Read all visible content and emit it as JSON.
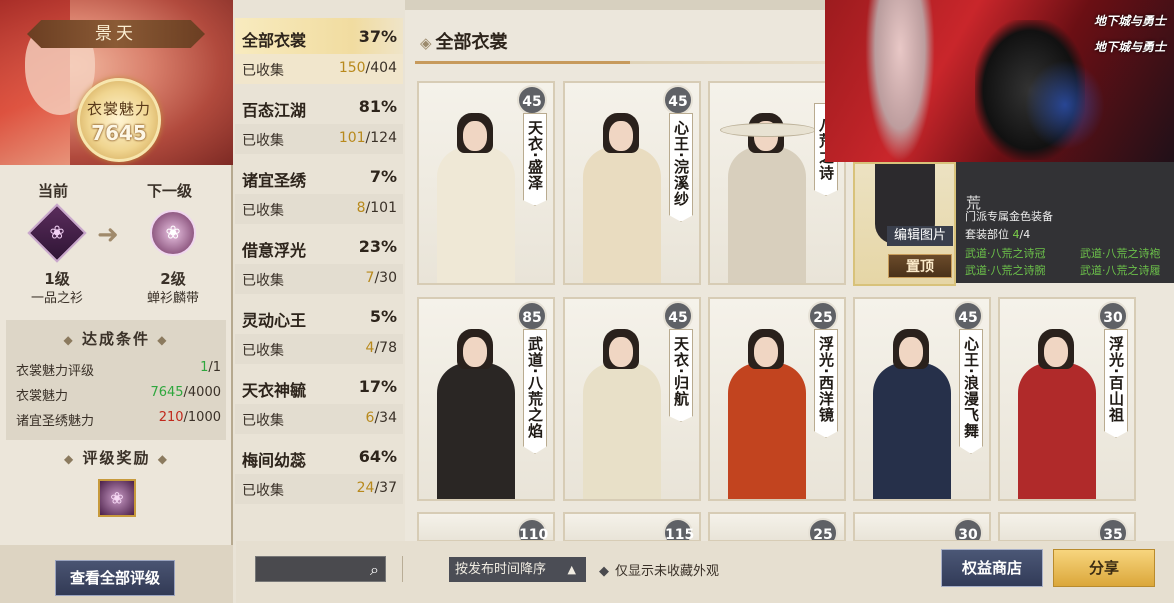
{
  "character": {
    "name": "景天",
    "charm_label": "衣裳魅力",
    "charm_value": "7645"
  },
  "level": {
    "current_label": "当前",
    "next_label": "下一级",
    "current_level": "1级",
    "current_name": "一品之衫",
    "next_level": "2级",
    "next_name": "蝉衫麟带"
  },
  "conditions": {
    "title": "达成条件",
    "rows": [
      {
        "label": "衣裳魅力评级",
        "done": "1",
        "total": "/1"
      },
      {
        "label": "衣裳魅力",
        "done": "7645",
        "total": "/4000"
      },
      {
        "label": "诸宜圣绣魅力",
        "done": "210",
        "total": "/1000"
      }
    ]
  },
  "reward": {
    "title": "评级奖励"
  },
  "view_all_button": "查看全部评级",
  "categories": [
    {
      "name": "全部衣裳",
      "percent": "37%",
      "collected_label": "已收集",
      "have": "150",
      "total": "/404"
    },
    {
      "name": "百态江湖",
      "percent": "81%",
      "collected_label": "已收集",
      "have": "101",
      "total": "/124"
    },
    {
      "name": "诸宜圣绣",
      "percent": "7%",
      "collected_label": "已收集",
      "have": "8",
      "total": "/101"
    },
    {
      "name": "借意浮光",
      "percent": "23%",
      "collected_label": "已收集",
      "have": "7",
      "total": "/30"
    },
    {
      "name": "灵动心王",
      "percent": "5%",
      "collected_label": "已收集",
      "have": "4",
      "total": "/78"
    },
    {
      "name": "天衣神毓",
      "percent": "17%",
      "collected_label": "已收集",
      "have": "6",
      "total": "/34"
    },
    {
      "name": "梅间幼蕊",
      "percent": "64%",
      "collected_label": "已收集",
      "have": "24",
      "total": "/37"
    }
  ],
  "section_title": "全部衣裳",
  "outfits_row1": [
    {
      "level": "45",
      "name": "天衣·盛泽",
      "color": "#efe8d6"
    },
    {
      "level": "45",
      "name": "心王·浣溪纱",
      "color": "#e9dcc0"
    },
    {
      "level": "",
      "name": "·八荒之诗",
      "color": "#d8cfbd"
    }
  ],
  "outfits_row2": [
    {
      "level": "85",
      "name": "武道·八荒之焰",
      "color": "#2a2624"
    },
    {
      "level": "45",
      "name": "天衣·归航",
      "color": "#e8e0c8"
    },
    {
      "level": "25",
      "name": "浮光·西洋镜",
      "color": "#c2441f"
    },
    {
      "level": "45",
      "name": "心王·浪漫飞舞",
      "color": "#26304a"
    },
    {
      "level": "30",
      "name": "浮光·百山祖",
      "color": "#b02a2a"
    }
  ],
  "outfits_row3": [
    "110",
    "115",
    "25",
    "30",
    "35"
  ],
  "overlay": {
    "logo1": "地下城与勇士",
    "logo2": "地下城与勇士"
  },
  "tooltip": {
    "edit_label": "编辑图片",
    "pin_label": "置顶",
    "top_char": "荒",
    "line1": "门派专属金色装备",
    "line2_label": "套装部位",
    "line2_have": "4",
    "line2_total": "/4",
    "items": [
      "武道·八荒之诗冠",
      "武道·八荒之诗袍",
      "武道·八荒之诗腕",
      "武道·八荒之诗履"
    ]
  },
  "bottom": {
    "search_placeholder": "",
    "sort_label": "按发布时间降序",
    "filter_label": "仅显示未收藏外观",
    "shop_button": "权益商店",
    "share_button": "分享"
  }
}
